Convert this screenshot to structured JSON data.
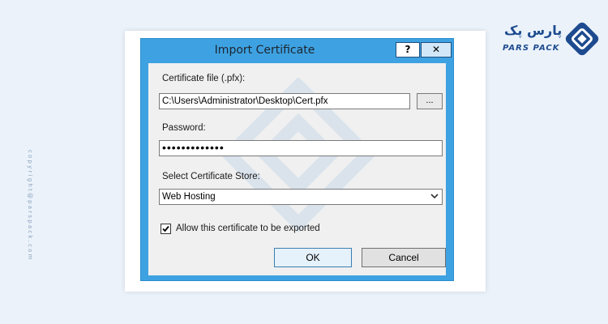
{
  "page": {
    "copyright": "copyright@parspack.com",
    "brand_fa": "پارس پک",
    "brand_en": "PARS PACK"
  },
  "dialog": {
    "title": "Import Certificate",
    "help_label": "?",
    "close_label": "✕",
    "cert_file_label": "Certificate file (.pfx):",
    "cert_file_value": "C:\\Users\\Administrator\\Desktop\\Cert.pfx",
    "browse_label": "...",
    "password_label": "Password:",
    "password_value": "•••••••••••••",
    "store_label": "Select Certificate Store:",
    "store_value": "Web Hosting",
    "allow_export_label": "Allow this certificate to be exported",
    "allow_export_checked": true,
    "ok_label": "OK",
    "cancel_label": "Cancel"
  },
  "colors": {
    "title_bar": "#3ea2e2",
    "background": "#ebf2fa",
    "brand": "#1e4b8f"
  },
  "icons": [
    "diamond-logo-icon",
    "chevron-down-icon",
    "checkmark-icon",
    "close-icon",
    "help-icon"
  ]
}
